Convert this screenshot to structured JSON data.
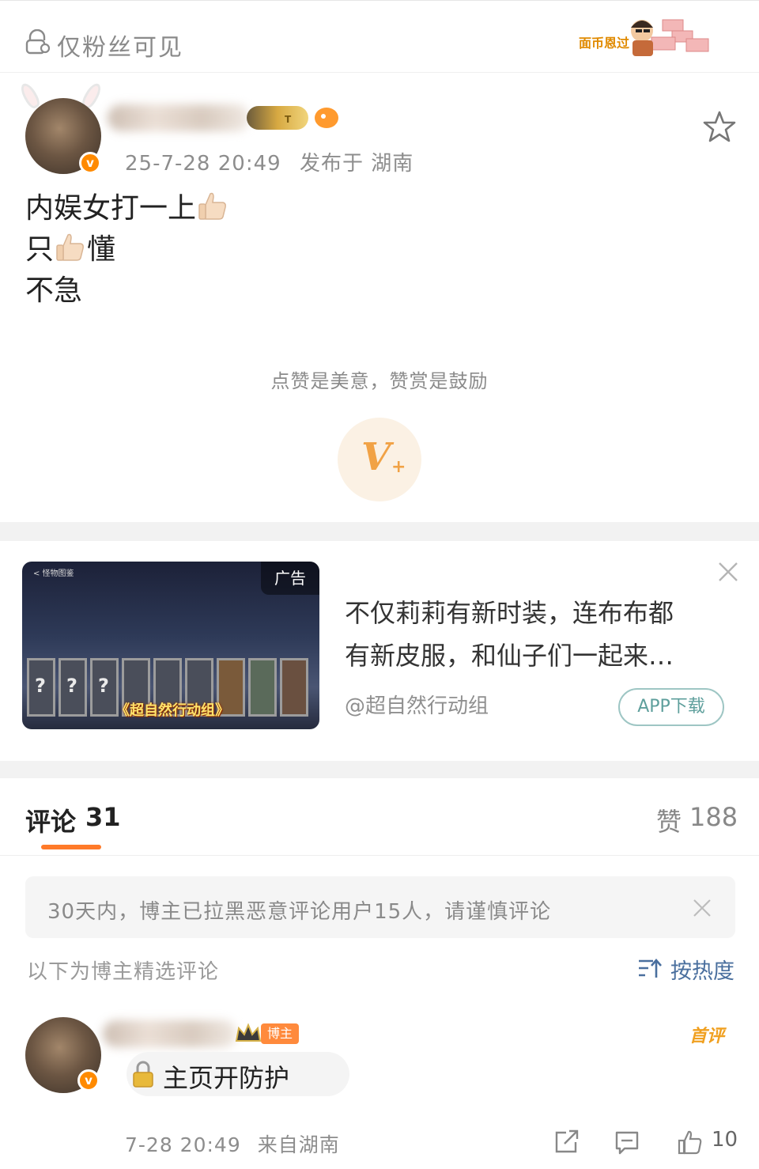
{
  "visibility_bar": {
    "text": "仅粉丝可见",
    "sticker_text": "面币恩过"
  },
  "post": {
    "timestamp": "25-7-28 20:49",
    "location": "发布于 湖南",
    "lines": [
      {
        "before": "内娱女打一上",
        "after": ""
      },
      {
        "before": "只",
        "after": "懂"
      },
      {
        "before": "不急",
        "after": ""
      }
    ],
    "crown_badge_text": "T"
  },
  "reward": {
    "tip": "点赞是美意，赞赏是鼓励",
    "button_v": "V",
    "button_plus": "+"
  },
  "ad": {
    "label": "广告",
    "thumb_topbar": "< 怪物图鉴",
    "game_title": "《超自然行动组》",
    "title_line1": "不仅莉莉有新时装，连布布都",
    "title_line2": "有新皮服，和仙子们一起来…",
    "source": "@超自然行动组",
    "button": "APP下载",
    "panel_marks": [
      "?",
      "?",
      "?"
    ]
  },
  "comments": {
    "tab_label": "评论",
    "count": "31",
    "likes_label": "赞",
    "likes_count": "188",
    "notice": "30天内，博主已拉黑恶意评论用户15人，请谨慎评论",
    "selected_label": "以下为博主精选评论",
    "sort_label": "按热度",
    "first": {
      "host_badge": "博主",
      "first_tag": "首评",
      "text": "主页开防护",
      "timestamp": "7-28 20:49",
      "location": "来自湖南",
      "like_count": "10"
    }
  },
  "colors": {
    "accent_orange": "#ff7a29",
    "link_blue": "#4a6f9e",
    "verified_orange": "#ff8a00"
  },
  "icons": {
    "visibility": "fans-lock-icon",
    "favorite": "star-icon",
    "ad_close": "close-icon",
    "notice_close": "close-icon",
    "sort": "sort-icon",
    "share": "share-icon",
    "comment": "comment-icon",
    "like": "thumb-up-icon"
  }
}
